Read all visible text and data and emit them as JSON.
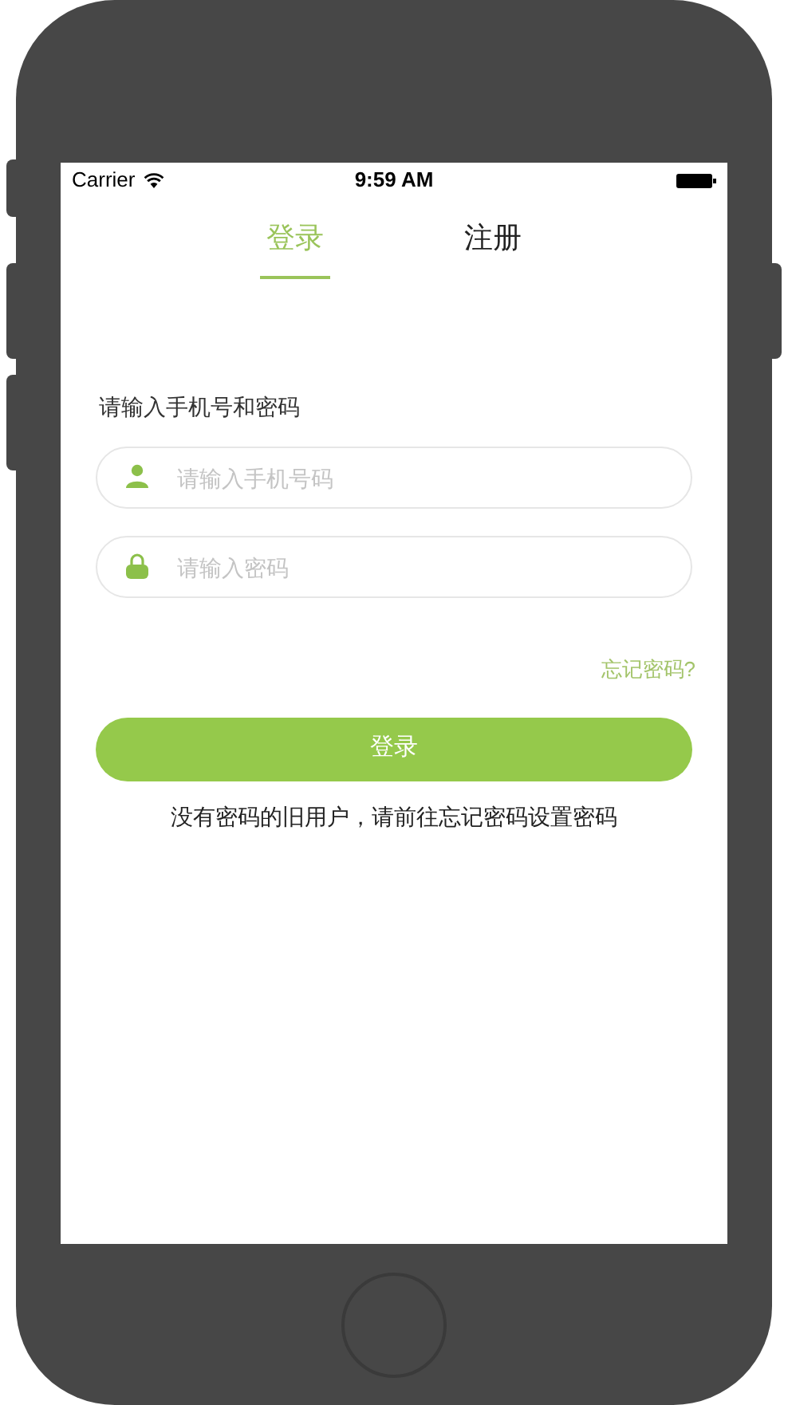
{
  "status_bar": {
    "carrier": "Carrier",
    "time": "9:59 AM"
  },
  "tabs": [
    {
      "label": "登录",
      "selected": true
    },
    {
      "label": "注册",
      "selected": false
    }
  ],
  "prompt": "请输入手机号和密码",
  "fields": [
    {
      "kind": "phone",
      "placeholder": "请输入手机号码"
    },
    {
      "kind": "password",
      "placeholder": "请输入密码"
    }
  ],
  "forgot_link": "忘记密码?",
  "login_button": "登录",
  "note": "没有密码的旧用户，请前往忘记密码设置密码"
}
